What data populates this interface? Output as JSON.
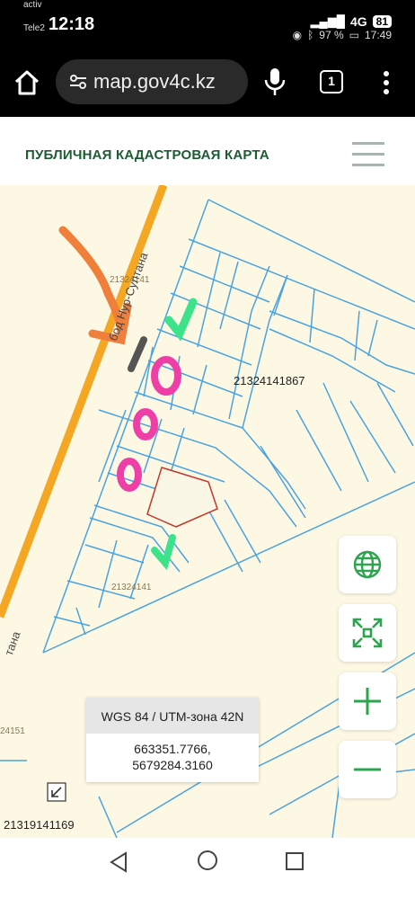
{
  "status_bar": {
    "carrier_line1": "activ",
    "carrier_line2": "Tele2",
    "time": "12:18",
    "signal_text": "▐▐▐ ▐▐▐",
    "network": "4G",
    "battery_badge": "81",
    "battery_percent": "97 %",
    "clock_right": "17:49"
  },
  "browser": {
    "url": "map.gov4c.kz",
    "tab_count": "1"
  },
  "site": {
    "title": "ПУБЛИЧНАЯ КАДАСТРОВАЯ КАРТА"
  },
  "map": {
    "labels": {
      "block_top": "21324141",
      "parcel_main": "21324141867",
      "block_bottom": "21324141",
      "block_left": "24151",
      "parcel_bottom": "21319141169"
    },
    "road_name": "бод Нур-Султана",
    "road_name_lower": "тана",
    "coord_system": "WGS 84 / UTM-зона 42N",
    "coord_x": "663351.7766,",
    "coord_y": "5679284.3160",
    "colors": {
      "parcel_line": "#4aa3df",
      "selected_parcel": "#c0392b",
      "road": "#f5a623",
      "button_icon": "#2ea44f"
    }
  },
  "map_controls": {
    "layers": "globe-icon",
    "fullscreen": "expand-icon",
    "zoom_in": "+",
    "zoom_out": "−"
  }
}
